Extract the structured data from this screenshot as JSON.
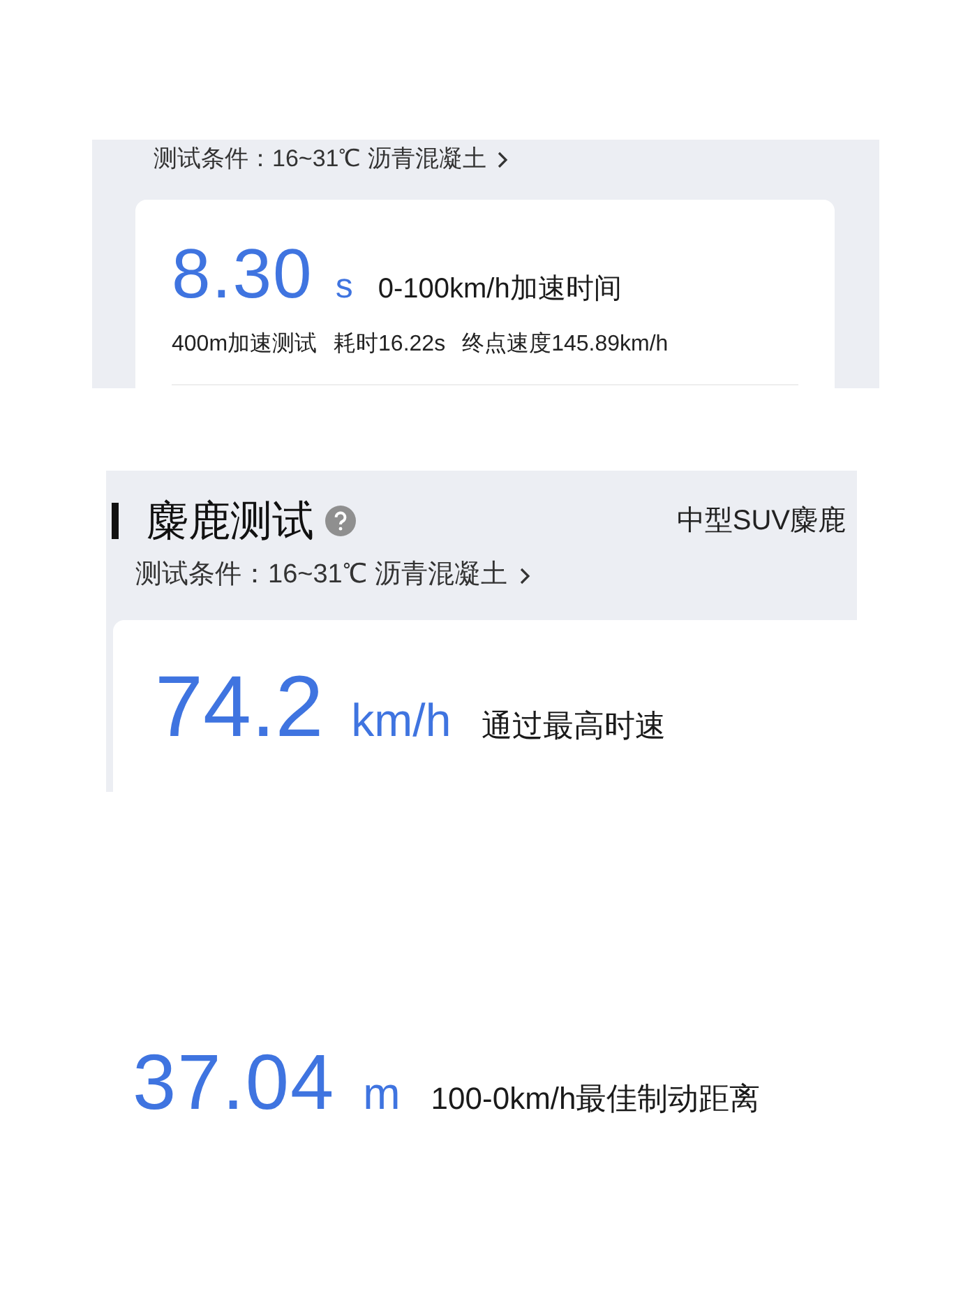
{
  "panels": [
    {
      "kind": "acceleration",
      "condition": "测试条件：16~31℃  沥青混凝土",
      "value": "8.30",
      "unit": "s",
      "label": "0-100km/h加速时间",
      "details": [
        "400m加速测试",
        "耗时16.22s",
        "终点速度145.89km/h"
      ]
    },
    {
      "kind": "moose",
      "title": "麋鹿测试",
      "category": "中型SUV麋鹿",
      "condition": "测试条件：16~31℃  沥青混凝土",
      "value": "74.2",
      "unit": "km/h",
      "label": "通过最高时速"
    },
    {
      "kind": "braking",
      "value": "37.04",
      "unit": "m",
      "label": "100-0km/h最佳制动距离"
    }
  ]
}
